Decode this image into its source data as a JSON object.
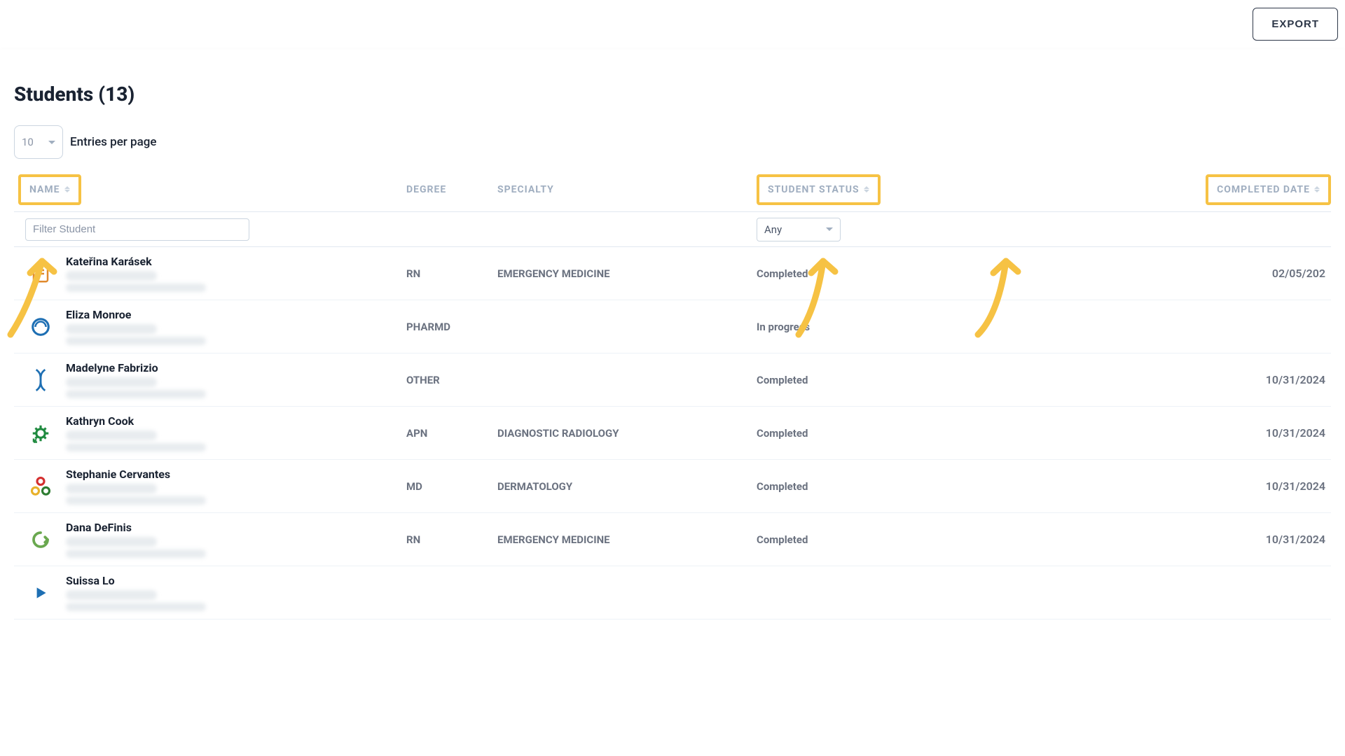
{
  "toolbar": {
    "export_label": "EXPORT"
  },
  "students": {
    "title_prefix": "Students",
    "count": 13,
    "page_size": "10",
    "entries_label": "Entries per page",
    "columns": {
      "name": "NAME",
      "degree": "DEGREE",
      "specialty": "SPECIALTY",
      "status": "STUDENT STATUS",
      "completed": "COMPLETED DATE"
    },
    "filter_placeholder": "Filter Student",
    "status_filter_value": "Any",
    "rows": [
      {
        "name": "Kateřina Karásek",
        "degree": "RN",
        "specialty": "EMERGENCY MEDICINE",
        "status": "Completed",
        "completed": "02/05/202",
        "icon": "doc",
        "icon_color": "#e08a2e"
      },
      {
        "name": "Eliza Monroe",
        "degree": "PHARMD",
        "specialty": "",
        "status": "In progress",
        "completed": "",
        "icon": "swirl",
        "icon_color": "#1e6fb3"
      },
      {
        "name": "Madelyne Fabrizio",
        "degree": "OTHER",
        "specialty": "",
        "status": "Completed",
        "completed": "10/31/2024",
        "icon": "dna",
        "icon_color": "#1e6fb3"
      },
      {
        "name": "Kathryn Cook",
        "degree": "APN",
        "specialty": "DIAGNOSTIC RADIOLOGY",
        "status": "Completed",
        "completed": "10/31/2024",
        "icon": "gear",
        "icon_color": "#1f8a3f"
      },
      {
        "name": "Stephanie Cervantes",
        "degree": "MD",
        "specialty": "DERMATOLOGY",
        "status": "Completed",
        "completed": "10/31/2024",
        "icon": "tri",
        "icon_color": "#e08a2e"
      },
      {
        "name": "Dana DeFinis",
        "degree": "RN",
        "specialty": "EMERGENCY MEDICINE",
        "status": "Completed",
        "completed": "10/31/2024",
        "icon": "cycle",
        "icon_color": "#6aa84f"
      },
      {
        "name": "Suissa Lo",
        "degree": "",
        "specialty": "",
        "status": "",
        "completed": "",
        "icon": "play",
        "icon_color": "#1e6fb3"
      }
    ]
  },
  "annotations": {
    "highlight_color": "#f6c244",
    "arrows": [
      "name",
      "status",
      "completed"
    ]
  }
}
